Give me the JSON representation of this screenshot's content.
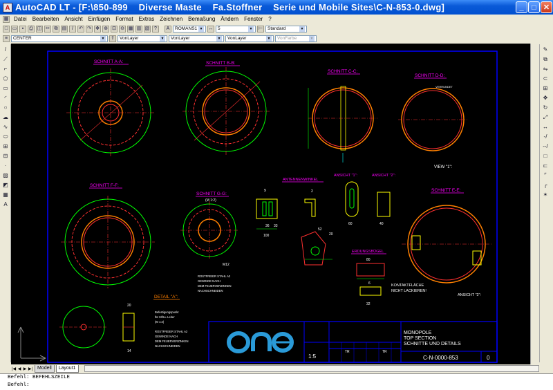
{
  "window": {
    "title": "AutoCAD LT - [F:\\850-899    Diverse Maste    Fa.Stoffner    Serie und Mobile Sites\\C-N-853-0.dwg]",
    "minimize": "_",
    "maximize": "□",
    "close": "✕"
  },
  "menu": [
    "Datei",
    "Bearbeiten",
    "Ansicht",
    "Einfügen",
    "Format",
    "Extras",
    "Zeichnen",
    "Bemaßung",
    "Ändern",
    "Fenster",
    "?"
  ],
  "toolbar": {
    "textstyle": "ROMANS1",
    "textheight": "5",
    "dimstyle": "Standard"
  },
  "properties_bar": {
    "layer": "CENTER",
    "color": "VonLayer",
    "linetype": "VonLayer",
    "lineweight": "VonLayer",
    "plotstyle": "VonFarbe"
  },
  "drawing": {
    "sections": {
      "a": "SCHNITT A-A:",
      "b": "SCHNITT B-B:",
      "c": "SCHNITT C-C:",
      "d": "SCHNITT D-D:",
      "e": "SCHNITT E-E:",
      "f": "SCHNITT F-F:",
      "g": "SCHNITT G-G:"
    },
    "labels": {
      "antennenwinkel": "ANTENNENWINKEL",
      "ansicht1": "ANSICHT \"1\":",
      "ansicht2": "ANSICHT \"2\":",
      "erdung": "ERDUNGSBÜGEL",
      "view1": "VIEW \"1\":",
      "detail": "DETAIL \"A\":",
      "ansicht2b": "ANSICHT \"2\":",
      "scale12": "(M 1:2)",
      "verrundet": "VERRUNDET",
      "kontakt1": "KONTAKTFLÄCHE",
      "kontakt2": "NICHT LACKIEREN!",
      "rost1": "ROSTFREIER STAHL A2",
      "rost2": "GEWINDE NACH",
      "rost3": "DEM FEUERVERZINKEN",
      "rost4": "NACHSCHNEIDEN",
      "befest1": "Befestigungspunkt",
      "befest2": "für SÖLL-Leiter",
      "befest3": "(M 1:2)",
      "m12": "M12",
      "dim100": "100",
      "dim60": "60",
      "dim40": "40",
      "dim80": "80",
      "dim52": "52",
      "dim32": "32",
      "dim20": "20",
      "dim14": "14",
      "dim6": "6",
      "dim9": "9",
      "dim2": "2",
      "dim36": "36",
      "dim33": "33"
    },
    "titleblock": {
      "logo": "one",
      "scale": "1:5",
      "title1": "MONOPOLE",
      "title2": "TOP SECTION",
      "title3": "SCHNITTE UND DETAILS",
      "drawing_no": "C-N-0000-853",
      "revision": "0",
      "tr1": "TR",
      "tr2": "TR"
    }
  },
  "tabs": {
    "model": "Modell",
    "layout": "Layout1"
  },
  "command": {
    "line1": "Befehl: BEFEHLSZEILE",
    "line2": "Befehl:"
  },
  "colors": {
    "canvas": "#000000",
    "frame": "#0000ff",
    "magenta": "#ff00ff",
    "green": "#00ff00",
    "red": "#ff3030",
    "orange": "#ff8000",
    "yellow": "#ffff00",
    "cyan": "#00ffff"
  }
}
